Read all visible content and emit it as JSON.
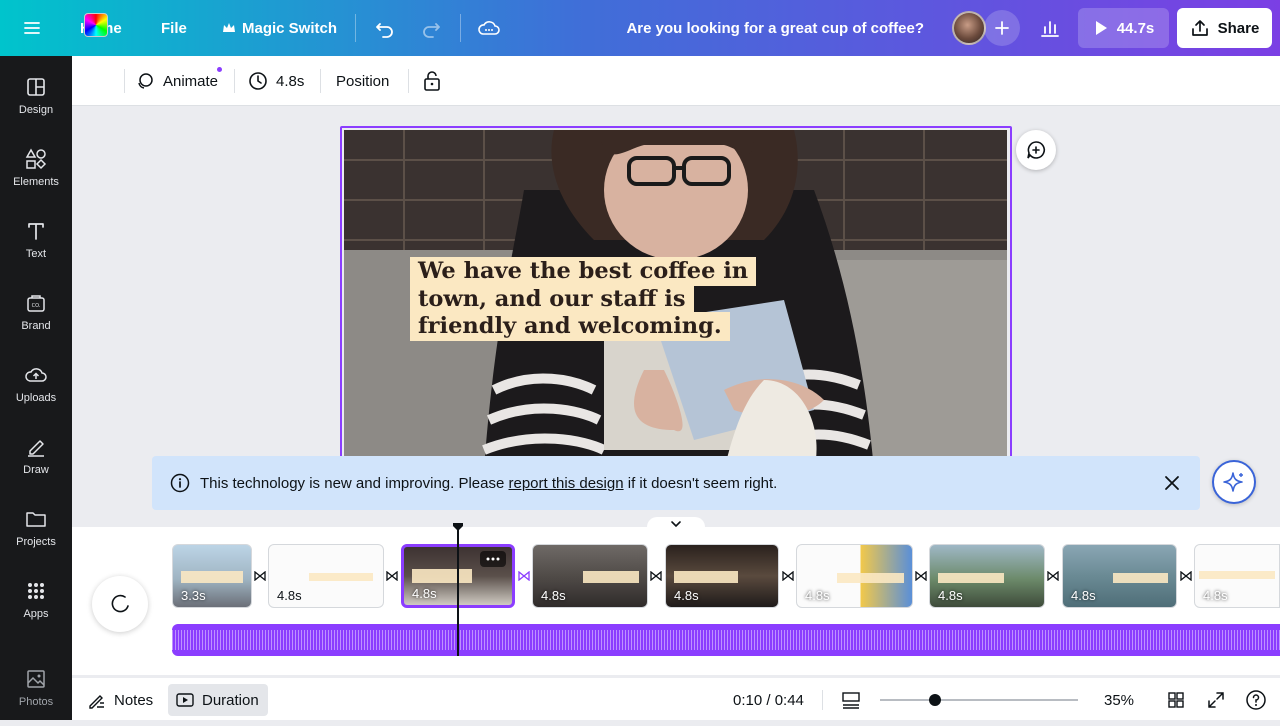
{
  "topbar": {
    "home": "Home",
    "file": "File",
    "magic_switch": "Magic Switch",
    "design_title": "Are you looking for a great cup of coffee?",
    "play_duration": "44.7s",
    "share": "Share"
  },
  "sidebar": {
    "items": [
      {
        "label": "Design",
        "icon": "design-icon"
      },
      {
        "label": "Elements",
        "icon": "elements-icon"
      },
      {
        "label": "Text",
        "icon": "text-icon"
      },
      {
        "label": "Brand",
        "icon": "brand-icon"
      },
      {
        "label": "Uploads",
        "icon": "uploads-icon"
      },
      {
        "label": "Draw",
        "icon": "draw-icon"
      },
      {
        "label": "Projects",
        "icon": "projects-icon"
      },
      {
        "label": "Apps",
        "icon": "apps-icon"
      },
      {
        "label": "Photos",
        "icon": "photos-icon"
      }
    ]
  },
  "toolbar": {
    "animate": "Animate",
    "duration": "4.8s",
    "position": "Position"
  },
  "canvas": {
    "caption": "We have the best coffee in town, and our staff is friendly and welcoming."
  },
  "banner": {
    "text_before": "This technology is new and improving. Please ",
    "link": "report this design",
    "text_after": " if it doesn't seem right."
  },
  "timeline": {
    "clips": [
      {
        "duration": "3.3s",
        "caption": "are you looking for a great cup of coffee?"
      },
      {
        "duration": "4.8s",
        "caption": "look no further than Brown Beans!"
      },
      {
        "duration": "4.8s",
        "caption": "We have the best coffee in town, and our staff is friendly and welcoming."
      },
      {
        "duration": "4.8s",
        "caption": "come on in and try one of our delicious pastries or sandwiches!"
      },
      {
        "duration": "4.8s",
        "caption": "We also have a great selection of beans and brews to pick up on your way."
      },
      {
        "duration": "4.8s",
        "caption": "Don't forget to check out our amazing selection of gift cards"
      },
      {
        "duration": "4.8s",
        "caption": "We're open seven days a week, so come on by and see us soon!"
      },
      {
        "duration": "4.8s",
        "caption": "We're located at 123 Main Street, and our phone number is 555-555-5555."
      },
      {
        "duration": "4.8s",
        "caption": "We can't wait to see you!"
      }
    ]
  },
  "bottombar": {
    "notes": "Notes",
    "duration": "Duration",
    "time": "0:10 / 0:44",
    "zoom": "35%",
    "zoom_level": 0.28
  },
  "colors": {
    "accent": "#8b3dff",
    "banner_bg": "#d1e4fb",
    "sidebar_bg": "#18191b",
    "caption_bg": "#fbe8c2"
  }
}
